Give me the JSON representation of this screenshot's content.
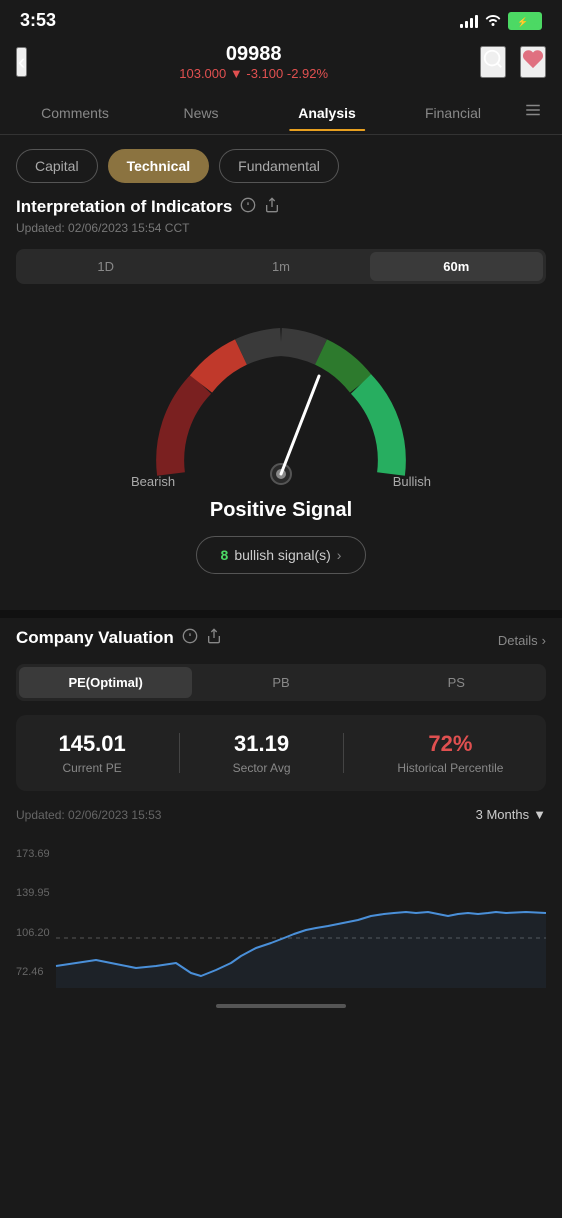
{
  "statusBar": {
    "time": "3:53"
  },
  "header": {
    "ticker": "09988",
    "price": "103.000",
    "change": "-3.100",
    "changePct": "-2.92%",
    "backLabel": "‹",
    "searchLabel": "○",
    "heartLabel": "♥"
  },
  "navTabs": [
    {
      "label": "Comments",
      "active": false
    },
    {
      "label": "News",
      "active": false
    },
    {
      "label": "Analysis",
      "active": true
    },
    {
      "label": "Financial",
      "active": false
    }
  ],
  "subCats": [
    {
      "label": "Capital",
      "active": false
    },
    {
      "label": "Technical",
      "active": true
    },
    {
      "label": "Fundamental",
      "active": false
    }
  ],
  "indicators": {
    "title": "Interpretation of Indicators",
    "updated": "Updated: 02/06/2023 15:54 CCT",
    "timePeriods": [
      {
        "label": "1D",
        "active": false
      },
      {
        "label": "1m",
        "active": false
      },
      {
        "label": "60m",
        "active": true
      }
    ],
    "gauge": {
      "bearishLabel": "Bearish",
      "bullishLabel": "Bullish"
    },
    "signalText": "Positive Signal",
    "signalBadge": {
      "count": "8",
      "text": "bullish signal(s)",
      "chevron": ">"
    }
  },
  "companyValuation": {
    "title": "Company Valuation",
    "detailsLabel": "Details",
    "chevron": ">",
    "tabs": [
      {
        "label": "PE(Optimal)",
        "active": true
      },
      {
        "label": "PB",
        "active": false
      },
      {
        "label": "PS",
        "active": false
      }
    ],
    "metrics": [
      {
        "value": "145.01",
        "label": "Current PE",
        "red": false
      },
      {
        "value": "31.19",
        "label": "Sector Avg",
        "red": false
      },
      {
        "value": "72%",
        "label": "Historical Percentile",
        "red": true
      }
    ],
    "updated": "Updated:  02/06/2023 15:53",
    "monthsSelector": "3 Months",
    "chartLabels": [
      "173.69",
      "139.95",
      "106.20",
      "72.46"
    ],
    "chartDashedValue": "106.20"
  }
}
